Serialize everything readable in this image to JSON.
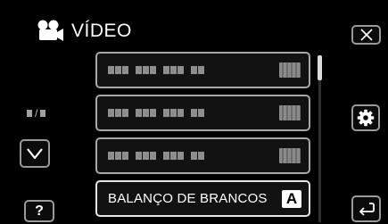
{
  "header": {
    "title": "VÍDEO",
    "icon": "video-camera-icon"
  },
  "buttons": {
    "close_icon": "close-icon",
    "settings_icon": "gear-icon",
    "down_icon": "chevron-down-icon",
    "help_label": "?",
    "back_icon": "return-icon"
  },
  "pager": {
    "separator": "/"
  },
  "menu": {
    "items": [
      {
        "label": "",
        "value_icon": "setting-value-icon"
      },
      {
        "label": "",
        "value_icon": "setting-value-icon"
      },
      {
        "label": "",
        "value_icon": "setting-value-icon"
      },
      {
        "label": "BALANÇO DE BRANCOS",
        "value": "A"
      }
    ]
  },
  "scrollbar": {
    "position_fraction": 0.0
  },
  "colors": {
    "background": "#000000",
    "border": "#9a9a9a",
    "text": "#ffffff",
    "selected": "#ffffff"
  }
}
